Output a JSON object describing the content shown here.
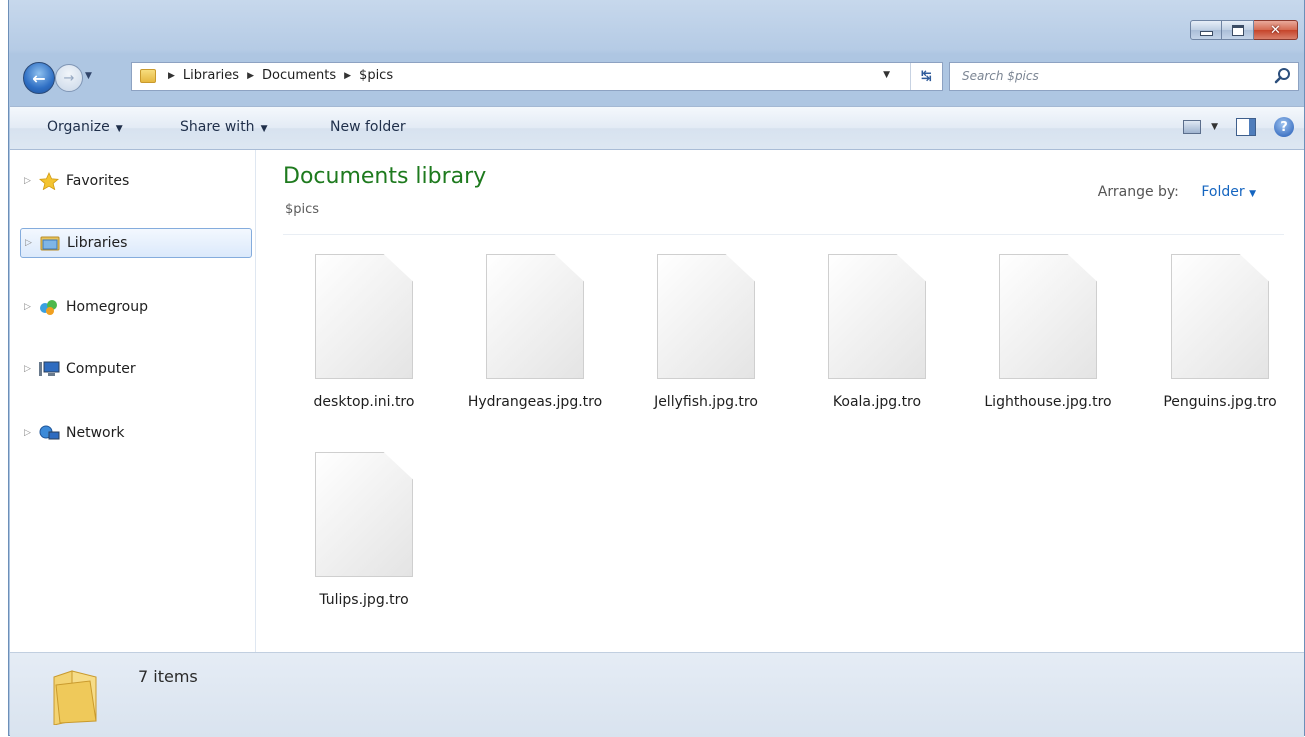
{
  "window": {
    "caption_buttons": [
      "minimize",
      "maximize",
      "close"
    ]
  },
  "address_bar": {
    "breadcrumbs": [
      "Libraries",
      "Documents",
      "$pics"
    ]
  },
  "search": {
    "placeholder": "Search $pics"
  },
  "toolbar": {
    "organize": "Organize",
    "share_with": "Share with",
    "new_folder": "New folder"
  },
  "sidebar": {
    "items": [
      {
        "label": "Favorites",
        "icon": "star-icon",
        "selected": false
      },
      {
        "label": "Libraries",
        "icon": "libraries-icon",
        "selected": true
      },
      {
        "label": "Homegroup",
        "icon": "homegroup-icon",
        "selected": false
      },
      {
        "label": "Computer",
        "icon": "computer-icon",
        "selected": false
      },
      {
        "label": "Network",
        "icon": "network-icon",
        "selected": false
      }
    ]
  },
  "library": {
    "title": "Documents library",
    "subtitle": "$pics",
    "arrange_label": "Arrange by:",
    "arrange_value": "Folder"
  },
  "files": [
    {
      "name": "desktop.ini.tro"
    },
    {
      "name": "Hydrangeas.jpg.tro"
    },
    {
      "name": "Jellyfish.jpg.tro"
    },
    {
      "name": "Koala.jpg.tro"
    },
    {
      "name": "Lighthouse.jpg.tro"
    },
    {
      "name": "Penguins.jpg.tro"
    },
    {
      "name": "Tulips.jpg.tro"
    }
  ],
  "status": {
    "count": "7 items"
  },
  "colors": {
    "library_title": "#1e7a1e",
    "link": "#1565c0",
    "selection_border": "#84acdd"
  }
}
